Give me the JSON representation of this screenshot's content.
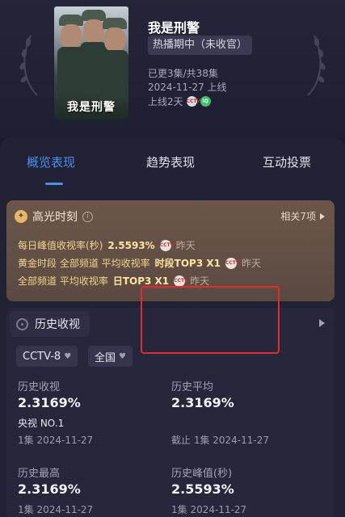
{
  "header": {
    "poster_title": "我是刑警",
    "show_title": "我是刑警",
    "status": "热播期中（未收官）",
    "episodes": "已更3集/共38集",
    "premiere": "2024-11-27 上线",
    "days_online": "上线2天",
    "badge_1": "CCTV",
    "badge_2": "iQ"
  },
  "tabs": [
    {
      "label": "概览表现",
      "active": true
    },
    {
      "label": "趋势表现",
      "active": false
    },
    {
      "label": "互动投票",
      "active": false
    }
  ],
  "highlight": {
    "title": "高光时刻",
    "related": "相关7项",
    "lines": [
      {
        "text": "每日峰值收视率(秒)",
        "value": "2.5593%",
        "badge": "CCTV",
        "when": "昨天"
      },
      {
        "text": "黄金时段 全部频道 平均收视率",
        "value": "时段TOP3 X1",
        "badge": "CCTV",
        "when": "昨天"
      },
      {
        "text": "全部频道 平均收视率",
        "value": "日TOP3 X1",
        "badge": "CCTV",
        "when": "昨天"
      }
    ]
  },
  "history": {
    "title": "历史收视",
    "filters": [
      "CCTV-8",
      "全国"
    ],
    "stats": {
      "total": {
        "label": "历史收视",
        "value": "2.3169%",
        "rank": "央视 NO.1",
        "sub": "1集 2024-11-27"
      },
      "avg": {
        "label": "历史平均",
        "value": "2.3169%",
        "sub": "截止 1集 2024-11-27"
      },
      "max": {
        "label": "历史最高",
        "value": "2.3169%",
        "sub": "1集 2024-11-27"
      },
      "peak": {
        "label": "历史峰值(秒)",
        "value": "2.5593%",
        "sub": "1集 2024-11-27"
      }
    }
  },
  "colors": {
    "accent": "#4a90f0",
    "highlight_text": "#f2d48a",
    "peak_outline": "#e52b2b"
  }
}
